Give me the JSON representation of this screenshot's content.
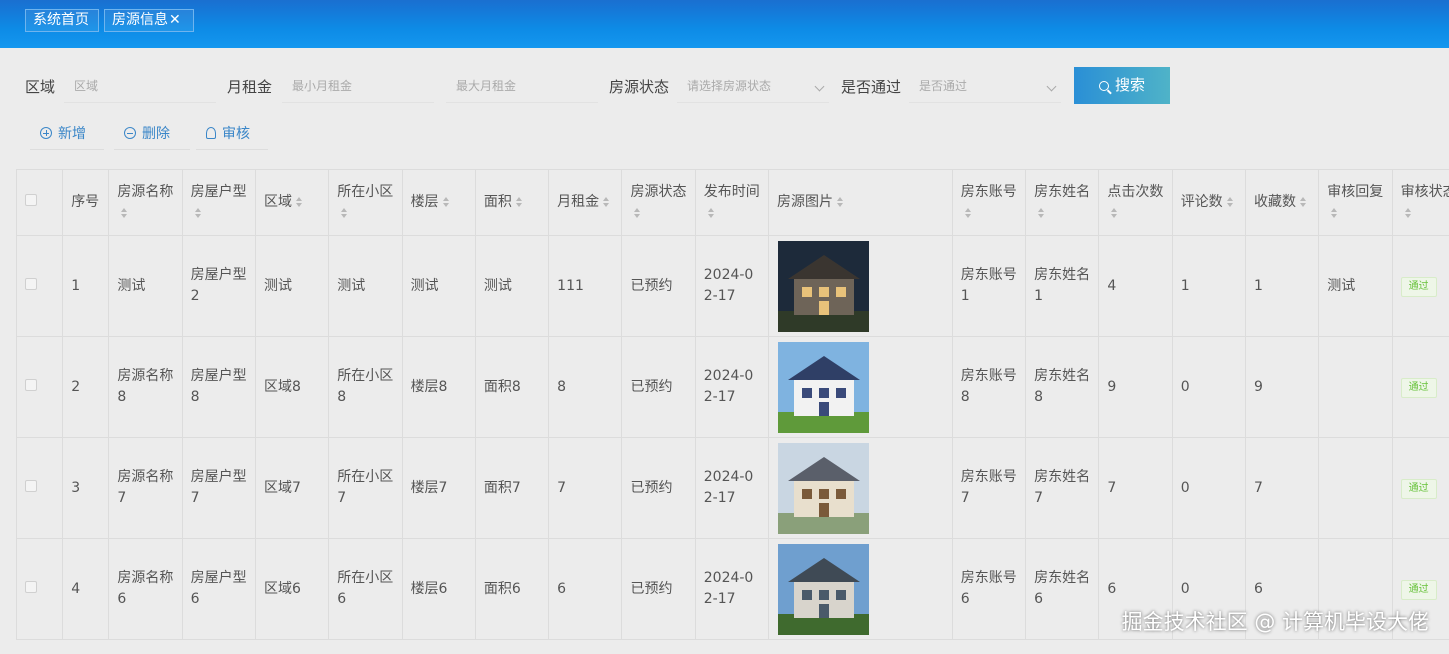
{
  "tabs": [
    {
      "label": "系统首页"
    },
    {
      "label": "房源信息",
      "close": "✕"
    }
  ],
  "filters": {
    "area_label": "区域",
    "area_placeholder": "区域",
    "rent_label": "月租金",
    "min_rent_placeholder": "最小月租金",
    "max_rent_placeholder": "最大月租金",
    "status_label": "房源状态",
    "status_placeholder": "请选择房源状态",
    "passed_label": "是否通过",
    "passed_placeholder": "是否通过",
    "search_label": "搜索"
  },
  "actions": {
    "add": "新增",
    "delete": "删除",
    "audit": "审核"
  },
  "columns": [
    "序号",
    "房源名称",
    "房屋户型",
    "区域",
    "所在小区",
    "楼层",
    "面积",
    "月租金",
    "房源状态",
    "发布时间",
    "房源图片",
    "房东账号",
    "房东姓名",
    "点击次数",
    "评论数",
    "收藏数",
    "审核回复",
    "审核状态"
  ],
  "rows": [
    {
      "no": "1",
      "name": "测试",
      "type": "房屋户型2",
      "area": "测试",
      "community": "测试",
      "floor": "测试",
      "size": "测试",
      "rent": "111",
      "status": "已预约",
      "date": "2024-02-17",
      "account": "房东账号1",
      "owner": "房东姓名1",
      "clicks": "4",
      "comments": "1",
      "favorites": "1",
      "reply": "测试",
      "audit": "通过",
      "photo": {
        "sky": "#1d2a3a",
        "wall": "#6e6458",
        "roof": "#3a3530",
        "ground": "#2f3a28",
        "lit": "#e8c27a"
      }
    },
    {
      "no": "2",
      "name": "房源名称8",
      "type": "房屋户型8",
      "area": "区域8",
      "community": "所在小区8",
      "floor": "楼层8",
      "size": "面积8",
      "rent": "8",
      "status": "已预约",
      "date": "2024-02-17",
      "account": "房东账号8",
      "owner": "房东姓名8",
      "clicks": "9",
      "comments": "0",
      "favorites": "9",
      "reply": "",
      "audit": "通过",
      "photo": {
        "sky": "#7fb3e0",
        "wall": "#f2f2f2",
        "roof": "#2f3f66",
        "ground": "#5f9a3a",
        "lit": "#3a4a7a"
      }
    },
    {
      "no": "3",
      "name": "房源名称7",
      "type": "房屋户型7",
      "area": "区域7",
      "community": "所在小区7",
      "floor": "楼层7",
      "size": "面积7",
      "rent": "7",
      "status": "已预约",
      "date": "2024-02-17",
      "account": "房东账号7",
      "owner": "房东姓名7",
      "clicks": "7",
      "comments": "0",
      "favorites": "7",
      "reply": "",
      "audit": "通过",
      "photo": {
        "sky": "#c9d6e2",
        "wall": "#e8dfcd",
        "roof": "#5a5f6a",
        "ground": "#8aa07a",
        "lit": "#7a5a3a"
      }
    },
    {
      "no": "4",
      "name": "房源名称6",
      "type": "房屋户型6",
      "area": "区域6",
      "community": "所在小区6",
      "floor": "楼层6",
      "size": "面积6",
      "rent": "6",
      "status": "已预约",
      "date": "2024-02-17",
      "account": "房东账号6",
      "owner": "房东姓名6",
      "clicks": "6",
      "comments": "0",
      "favorites": "6",
      "reply": "",
      "audit": "通过",
      "photo": {
        "sky": "#6f9fcf",
        "wall": "#d8d4cc",
        "roof": "#3f4a55",
        "ground": "#3f6a2e",
        "lit": "#4a5a6a"
      }
    }
  ],
  "watermark": "掘金技术社区 @ 计算机毕设大佬"
}
